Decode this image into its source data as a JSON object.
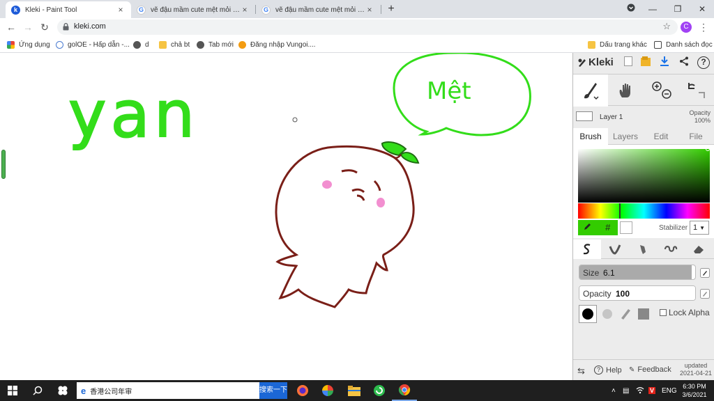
{
  "browser": {
    "tabs": [
      {
        "title": "Kleki - Paint Tool",
        "close": "×"
      },
      {
        "title": "vẽ đậu mầm cute mệt mỏi - Goo",
        "close": "×"
      },
      {
        "title": "vẽ đậu mầm cute mệt mỏi - Tim",
        "close": "×"
      }
    ],
    "new_tab": "+",
    "url": "kleki.com",
    "profile_initial": "C",
    "bookmarks": [
      {
        "label": "Ứng dụng"
      },
      {
        "label": "golOE - Hấp dẫn -..."
      },
      {
        "label": "d"
      },
      {
        "label": "chả bt"
      },
      {
        "label": "Tab mới"
      },
      {
        "label": "Đăng nhập Vungoi...."
      },
      {
        "label": "Dấu trang khác"
      },
      {
        "label": "Danh sách đọc"
      }
    ]
  },
  "canvas": {
    "text_yan": "yan",
    "speech_text": "Mệt",
    "colors": {
      "green": "#33dd1a",
      "brown": "#7a1f18",
      "pink": "#f28fd0"
    }
  },
  "kleki": {
    "logo": "Kleki",
    "layer": {
      "name": "Layer 1",
      "opacity_label": "Opacity",
      "opacity_value": "100%"
    },
    "tabs": [
      "Brush",
      "Layers",
      "Edit",
      "File"
    ],
    "active_tab": "Brush",
    "color": {
      "primary": "#33cc00",
      "secondary": "#ffffff",
      "hex_symbol": "#"
    },
    "stabilizer": {
      "label": "Stabilizer",
      "value": "1"
    },
    "size": {
      "label": "Size",
      "value": "6.1",
      "fraction": 0.97
    },
    "opacity": {
      "label": "Opacity",
      "value": "100",
      "fraction": 1.0
    },
    "lock_alpha": "Lock Alpha",
    "help": "Help",
    "feedback": "Feedback",
    "updated_label": "updated",
    "updated_date": "2021-04-21"
  },
  "taskbar": {
    "search_text": "香港公司年审",
    "search_button": "搜索一下",
    "language": "ENG",
    "time": "6:30 PM",
    "date": "3/6/2021"
  }
}
